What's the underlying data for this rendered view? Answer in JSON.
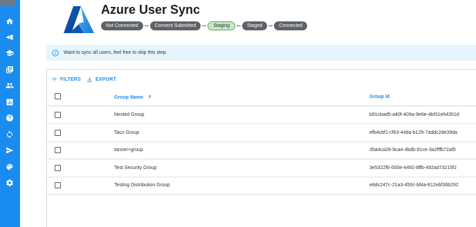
{
  "app": {
    "title": "Azure User Sync"
  },
  "sidebar": {
    "items": [
      {
        "icon": "home-icon"
      },
      {
        "icon": "megaphone-icon"
      },
      {
        "icon": "graduation-cap-icon"
      },
      {
        "icon": "documents-icon"
      },
      {
        "icon": "users-icon"
      },
      {
        "icon": "bar-chart-icon"
      },
      {
        "icon": "help-icon"
      },
      {
        "icon": "sync-icon"
      },
      {
        "icon": "send-icon"
      },
      {
        "icon": "palette-icon"
      },
      {
        "icon": "gear-icon"
      }
    ]
  },
  "stepper": {
    "steps": [
      "Not Connected",
      "Consent Submitted",
      "Staging",
      "Staged",
      "Connected"
    ],
    "active_step": "Staging"
  },
  "info": {
    "text": "Want to sync all users, feel free to skip this step."
  },
  "toolbar": {
    "filters_label": "FILTERS",
    "export_label": "EXPORT"
  },
  "table": {
    "columns": {
      "name": "Group Name",
      "id": "Group Id"
    },
    "rows": [
      {
        "name": "Nested Group",
        "id": "b91cbad5-a40f-409a-9e6e-4bf31e64351d"
      },
      {
        "name": "Taco Group",
        "id": "efb4cbf1-cf63-44da-b129-7addc2de39da"
      },
      {
        "name": "tanner+group",
        "id": "35a4ca28-9ca4-4bdb-91ce-3a2fffb72af0"
      },
      {
        "name": "Test Security Group",
        "id": "3e5322f6-000e-4492-8ffb-492ad73215f2"
      },
      {
        "name": "Testing Distribution Group",
        "id": "e8dc247c-21a3-450c-bf4a-812ebf36b292"
      }
    ]
  },
  "colors": {
    "sidebar": "#1a8cf0",
    "accent": "#1a8cf0",
    "step_default": "#5f6368",
    "step_active_bg": "#c8e6c9",
    "step_active_border": "#4caf50",
    "info_bg": "#e6f4fb"
  }
}
